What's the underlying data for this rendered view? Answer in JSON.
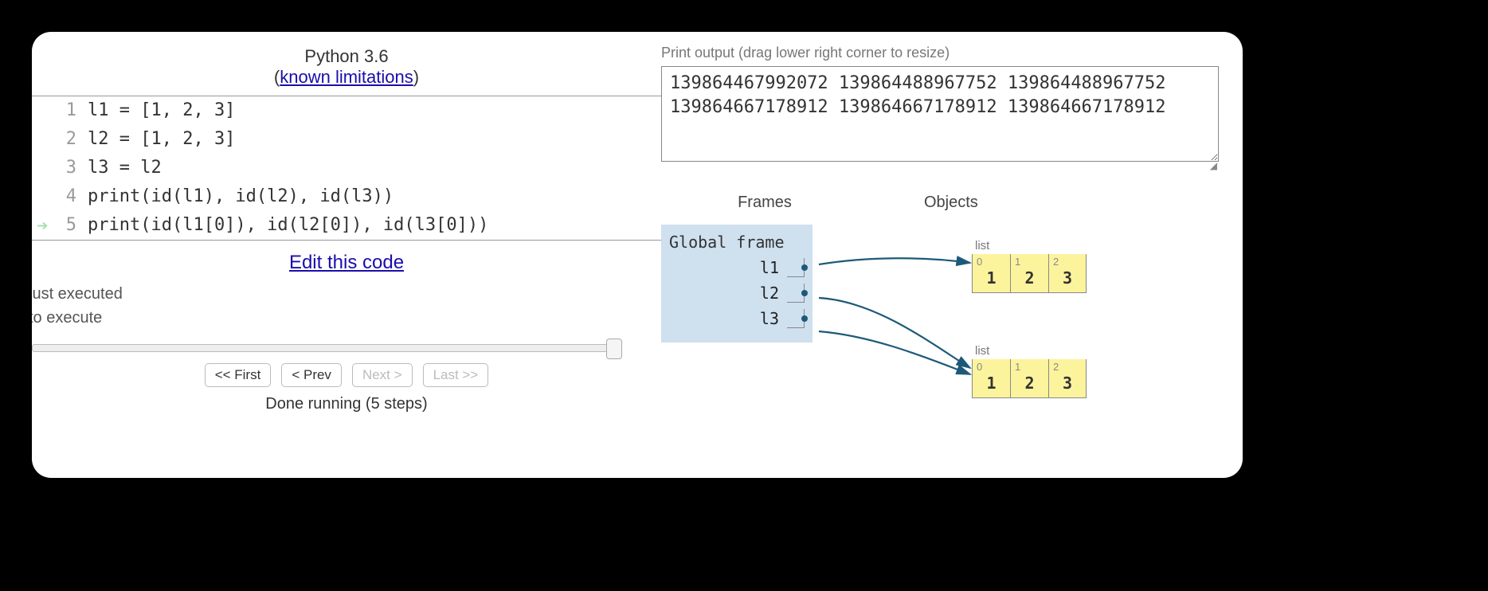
{
  "header": {
    "title": "Python 3.6",
    "limitations_prefix": "(",
    "limitations_link": "known limitations",
    "limitations_suffix": ")"
  },
  "code": {
    "lines": [
      {
        "n": "1",
        "text": "l1 = [1, 2, 3]"
      },
      {
        "n": "2",
        "text": "l2 = [1, 2, 3]"
      },
      {
        "n": "3",
        "text": "l3 = l2"
      },
      {
        "n": "4",
        "text": "print(id(l1), id(l2), id(l3))"
      },
      {
        "n": "5",
        "text": "print(id(l1[0]), id(l2[0]), id(l3[0]))"
      }
    ],
    "arrow_line_index": 4
  },
  "edit_link": "Edit this code",
  "legend": {
    "just_executed": "just executed",
    "next": " to execute"
  },
  "nav": {
    "first": "<< First",
    "prev": "< Prev",
    "next": "Next >",
    "last": "Last >>"
  },
  "status": "Done running (5 steps)",
  "output": {
    "label": "Print output (drag lower right corner to resize)",
    "text": "139864467992072 139864488967752 139864488967752\n139864667178912 139864667178912 139864667178912"
  },
  "viz": {
    "frames_header": "Frames",
    "objects_header": "Objects",
    "frame_title": "Global frame",
    "vars": [
      {
        "name": "l1"
      },
      {
        "name": "l2"
      },
      {
        "name": "l3"
      }
    ],
    "objects": [
      {
        "type": "list",
        "label": "list",
        "cells": [
          {
            "idx": "0",
            "val": "1"
          },
          {
            "idx": "1",
            "val": "2"
          },
          {
            "idx": "2",
            "val": "3"
          }
        ]
      },
      {
        "type": "list",
        "label": "list",
        "cells": [
          {
            "idx": "0",
            "val": "1"
          },
          {
            "idx": "1",
            "val": "2"
          },
          {
            "idx": "2",
            "val": "3"
          }
        ]
      }
    ]
  }
}
